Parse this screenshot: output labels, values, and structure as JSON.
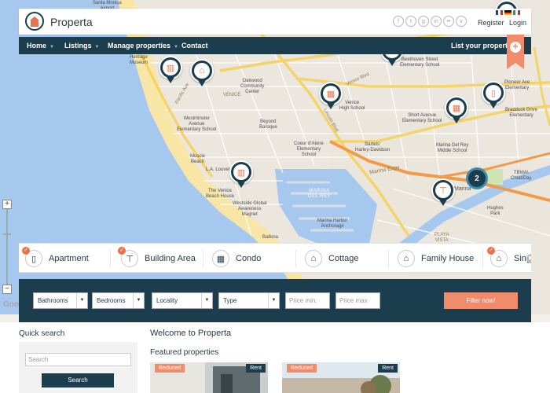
{
  "header": {
    "site_title": "Properta",
    "register_label": "Register",
    "login_label": "Login",
    "socials": [
      "f",
      "t",
      "g",
      "in",
      "••",
      "v"
    ]
  },
  "nav": {
    "items": [
      "Home",
      "Listings",
      "Manage properties",
      "Contact"
    ],
    "list_property_label": "List your property",
    "plus_label": "+"
  },
  "map": {
    "labels": {
      "santa_monica": "Santa Monica\nAirport",
      "heritage": "Heritage\nMuseum",
      "oakwood": "Oakwood\nCommunity\nCenter",
      "venice_area": "VENICE",
      "westminster": "Westminster\nAvenue\nElementary School",
      "beyond": "Beyond\nBaroque",
      "muscle_beach": "Muscle\nBeach",
      "la_louvel": "L.A. Louvel",
      "venice_beach_house": "The Venice\nBeach House",
      "westside": "Westside Global\nAwareness\nMagnet",
      "venice_hs": "Venice\nHigh School",
      "beethoven": "Beethoven Street\nElementary School",
      "short_ave": "Short Avenue\nElementary School",
      "coeur": "Coeur d'Alene\nElementary\nSchool",
      "bartels": "Bartels'\nHarley-Davidson",
      "marina_del_rey_basin": "MARINA\nDEL REY",
      "marina_harbor": "Marina Harbor\nAnchorage",
      "mdr_middle": "Marina Del Rey\nMiddle School",
      "marina_expy": "Marina Expy",
      "bradock": "Braddock Drive\nElementary",
      "tbwa": "TBWA\\\nChiat/Day",
      "hughes": "Hughes\nPark",
      "playa_vista": "PLAYA\nVISTA",
      "venice_blvd": "Venice Blvd",
      "pacific_ave": "Pacific Ave",
      "lincoln_blvd": "Lincoln Blvd",
      "marina": "Marina",
      "ballona": "Ballona",
      "pinner": "Pioneer Ave\nElementary"
    },
    "cluster_count": "2",
    "google_logo": "Google"
  },
  "categories": [
    {
      "label": "Apartment",
      "icon": "apartment-icon"
    },
    {
      "label": "Building Area",
      "icon": "crane-icon"
    },
    {
      "label": "Condo",
      "icon": "condo-icon"
    },
    {
      "label": "Cottage",
      "icon": "cottage-icon"
    },
    {
      "label": "Family House",
      "icon": "house-icon"
    },
    {
      "label": "Sing",
      "icon": "single-icon"
    }
  ],
  "filters": {
    "bathrooms": "Bathrooms",
    "bedrooms": "Bedrooms",
    "locality": "Locality",
    "type": "Type",
    "price_min_placeholder": "Price min.",
    "price_max_placeholder": "Price max",
    "filter_button": "Filter now!"
  },
  "quick_search": {
    "title": "Quick search",
    "placeholder": "Search",
    "button": "Search"
  },
  "content": {
    "welcome": "Welcome to Properta",
    "featured": "Featured properties",
    "cards": [
      {
        "badge_left": "Reduced",
        "badge_right": "Rent"
      },
      {
        "badge_left": "Reduced",
        "badge_right": "Rent"
      }
    ]
  },
  "colors": {
    "primary": "#1c3d4d",
    "accent": "#f08c6c",
    "water": "#a6c7ee",
    "beach": "#f7e6a5",
    "road_major": "#f4d36b",
    "road_highway": "#f29a4a"
  }
}
